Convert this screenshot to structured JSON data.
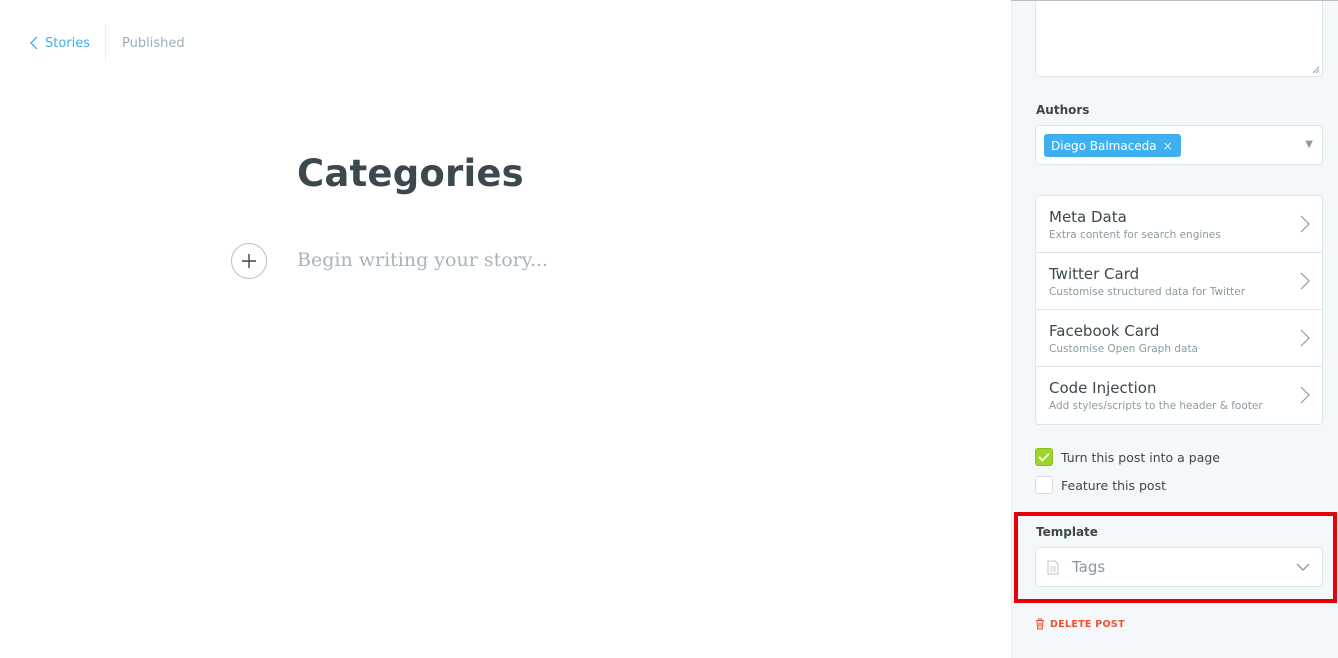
{
  "breadcrumb": {
    "back_label": "Stories",
    "status": "Published"
  },
  "editor": {
    "title": "Categories",
    "body_placeholder": "Begin writing your story..."
  },
  "settings": {
    "authors_label": "Authors",
    "authors": [
      {
        "name": "Diego Balmaceda",
        "remove": "×"
      }
    ],
    "nav_items": [
      {
        "title": "Meta Data",
        "description": "Extra content for search engines"
      },
      {
        "title": "Twitter Card",
        "description": "Customise structured data for Twitter"
      },
      {
        "title": "Facebook Card",
        "description": "Customise Open Graph data"
      },
      {
        "title": "Code Injection",
        "description": "Add styles/scripts to the header & footer"
      }
    ],
    "checkboxes": [
      {
        "label": "Turn this post into a page",
        "checked": true
      },
      {
        "label": "Feature this post",
        "checked": false
      }
    ],
    "template_label": "Template",
    "template_value": "Tags",
    "delete_label": "DELETE POST"
  },
  "colors": {
    "accent": "#3eb0ef",
    "danger": "#f05230",
    "check_green": "#9fd42c",
    "highlight": "#e5000a"
  },
  "icons": [
    "chevron-left-icon",
    "plus-icon",
    "chevron-right-icon",
    "check-icon",
    "document-icon",
    "chevron-down-icon",
    "trash-icon",
    "caret-down-icon"
  ]
}
